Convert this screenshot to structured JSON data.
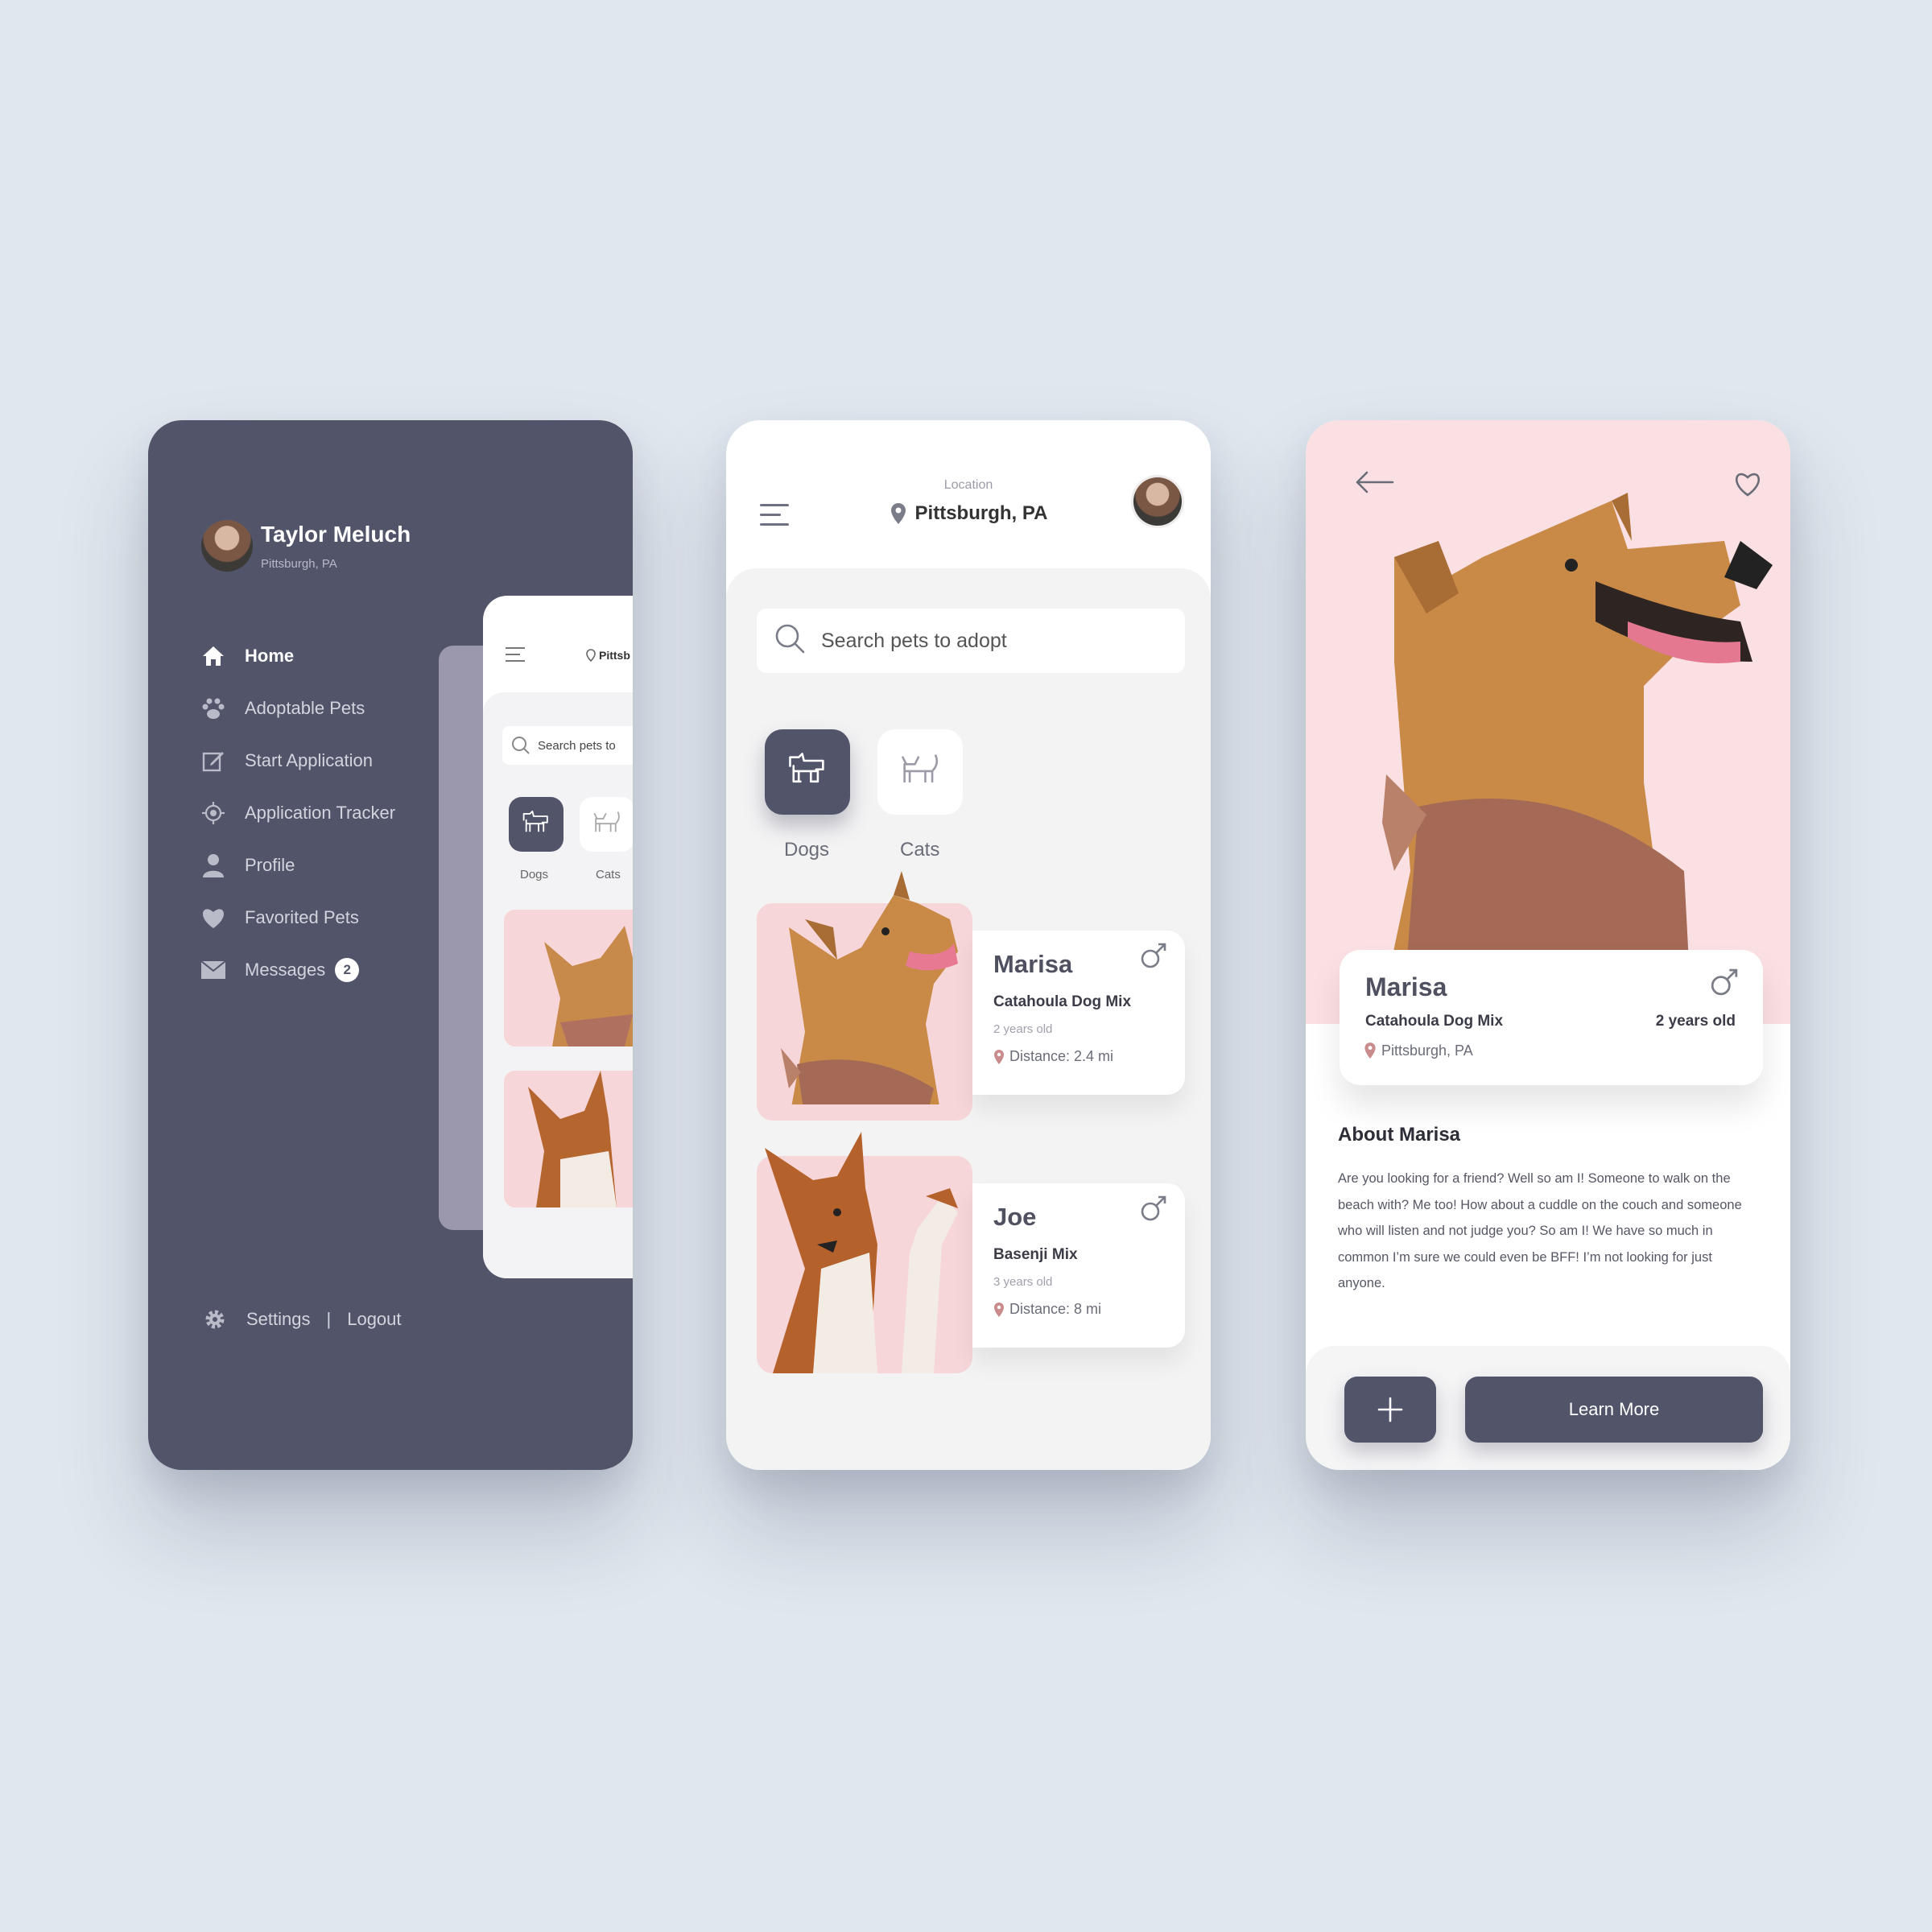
{
  "menu": {
    "user_name": "Taylor Meluch",
    "user_location": "Pittsburgh, PA",
    "items": [
      {
        "label": "Home",
        "icon": "home-icon"
      },
      {
        "label": "Adoptable Pets",
        "icon": "paw-icon"
      },
      {
        "label": "Start Application",
        "icon": "edit-icon"
      },
      {
        "label": "Application Tracker",
        "icon": "target-icon"
      },
      {
        "label": "Profile",
        "icon": "user-icon"
      },
      {
        "label": "Favorited Pets",
        "icon": "heart-icon"
      },
      {
        "label": "Messages",
        "icon": "mail-icon"
      }
    ],
    "messages_badge": "2",
    "settings_label": "Settings",
    "separator": "|",
    "logout_label": "Logout",
    "preview": {
      "location_value": "Pittsb",
      "search_placeholder": "Search pets to",
      "dogs_label": "Dogs",
      "cats_label": "Cats"
    }
  },
  "home": {
    "location_label": "Location",
    "location_value": "Pittsburgh, PA",
    "search_placeholder": "Search pets to adopt",
    "categories": [
      {
        "label": "Dogs",
        "selected": true
      },
      {
        "label": "Cats",
        "selected": false
      }
    ],
    "pets": [
      {
        "name": "Marisa",
        "breed": "Catahoula Dog Mix",
        "age": "2 years old",
        "distance": "Distance: 2.4 mi"
      },
      {
        "name": "Joe",
        "breed": "Basenji Mix",
        "age": "3 years old",
        "distance": "Distance: 8 mi"
      }
    ]
  },
  "detail": {
    "name": "Marisa",
    "breed": "Catahoula Dog Mix",
    "age": "2 years old",
    "location": "Pittsburgh, PA",
    "about_title": "About Marisa",
    "about_text": "Are you looking for a friend? Well so am I! Someone to walk on the beach with? Me too! How about a cuddle on the couch and someone who will listen and not judge you? So am I! We have so much in common I’m sure we could even be BFF! I’m not looking for just anyone.",
    "learn_more_label": "Learn More"
  },
  "colors": {
    "background": "#e0e7ee",
    "primary": "#52546a",
    "pink": "#f7d6d9",
    "pin": "#c98b8b"
  }
}
